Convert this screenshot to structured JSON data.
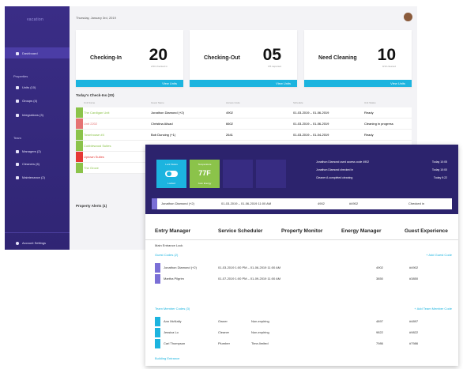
{
  "sidebar": {
    "logo": "vacation",
    "active_item": "Dashboard",
    "section_properties": "Properties",
    "items_properties": [
      "Units (10)",
      "Groups (4)",
      "Integrations (3)"
    ],
    "section_team": "Team",
    "items_team": [
      "Managers (2)",
      "Cleaners (6)",
      "Maintenance (2)"
    ],
    "bottom": "Account Settings"
  },
  "header": {
    "date": "Thursday, January 3rd, 2019"
  },
  "cards": [
    {
      "label": "Checking-In",
      "value": "20",
      "sub": "2/20 checked in",
      "action": "View Units"
    },
    {
      "label": "Checking-Out",
      "value": "05",
      "sub": "0/5 departed",
      "action": "View Units"
    },
    {
      "label": "Need Cleaning",
      "value": "10",
      "sub": "0/10 cleaned",
      "action": "View Units"
    }
  ],
  "checkins": {
    "title": "Today's Check-Ins (20)",
    "columns": [
      "Unit Name",
      "Guest Name",
      "Access Code",
      "Schedule",
      "Unit Status"
    ],
    "rows": [
      {
        "unit": "The Cardigan Unit",
        "guest": "Jonathon Diamond (+2)",
        "code": "4902",
        "schedule": "01-03-2019 – 01-06-2019",
        "status": "Ready",
        "color": "#8bc34a"
      },
      {
        "unit": "Unit 2202",
        "guest": "Christina Ailsad",
        "code": "6602",
        "schedule": "01-03-2019 – 01-06-2019",
        "status": "Cleaning in progress",
        "color": "#e57373"
      },
      {
        "unit": "Townhouse #4",
        "guest": "Bob Duncing (+1)",
        "code": "2641",
        "schedule": "01-03-2019 – 01-04-2019",
        "status": "Ready",
        "color": "#8bc34a"
      },
      {
        "unit": "Cobblewood Suites",
        "guest": "",
        "code": "",
        "schedule": "",
        "status": "",
        "color": "#8bc34a"
      },
      {
        "unit": "Uptown Suites",
        "guest": "",
        "code": "",
        "schedule": "",
        "status": "",
        "color": "#e53935"
      },
      {
        "unit": "The Grove",
        "guest": "",
        "code": "",
        "schedule": "",
        "status": "",
        "color": "#8bc34a"
      }
    ]
  },
  "alerts": {
    "title": "Property Alerts (1)"
  },
  "panel": {
    "lock_label": "Lock Status",
    "lock_state": "Locked",
    "temp_label": "Temperature",
    "temp_value": "77F",
    "temp_sub": "Auto Energy",
    "notes": [
      {
        "text": "Jonathon Diamond used access code 4902",
        "time": "Today 10:05"
      },
      {
        "text": "Jonathon Diamond checked in",
        "time": "Today 10:00"
      },
      {
        "text": "Cleaner A completed cleaning",
        "time": "Today 9:22"
      }
    ],
    "guest_row": {
      "name": "Jonathon Diamond (+2)",
      "dates": "01-03-2019 – 01-06-2019 11:00 AM",
      "code": "4902",
      "code2": "#4902",
      "status": "Checked in"
    },
    "tabs": [
      "Entry Manager",
      "Service Scheduler",
      "Property Monitor",
      "Energy Manager",
      "Guest Experience"
    ],
    "subtitle": "Main Entrance Lock",
    "guest_codes_title": "Guest Codes (2)",
    "guest_codes_add": "+ Add Guest Code",
    "guest_codes": [
      {
        "name": "Jonathon Diamond (+2)",
        "dates": "01-03-2019 1:00 PM – 01-06-2019 11:00 AM",
        "code": "4902",
        "code2": "#4902"
      },
      {
        "name": "Martha Pilgrim",
        "dates": "01-07-2019 1:00 PM – 01-09-2019 11:00 AM",
        "code": "3850",
        "code2": "#3850"
      }
    ],
    "team_codes_title": "Team Member Codes (3)",
    "team_codes_add": "+ Add Team Member Code",
    "team_codes": [
      {
        "name": "Ann McNally",
        "role": "Owner",
        "schedule": "Non-expiring",
        "code": "4897",
        "code2": "#4897"
      },
      {
        "name": "Jessica Lo",
        "role": "Cleaner",
        "schedule": "Non-expiring",
        "code": "9822",
        "code2": "#9822"
      },
      {
        "name": "Carl Thompson",
        "role": "Plumber",
        "schedule": "Time-limited",
        "code": "7986",
        "code2": "#7986"
      }
    ],
    "footer": "Building Entrance"
  }
}
